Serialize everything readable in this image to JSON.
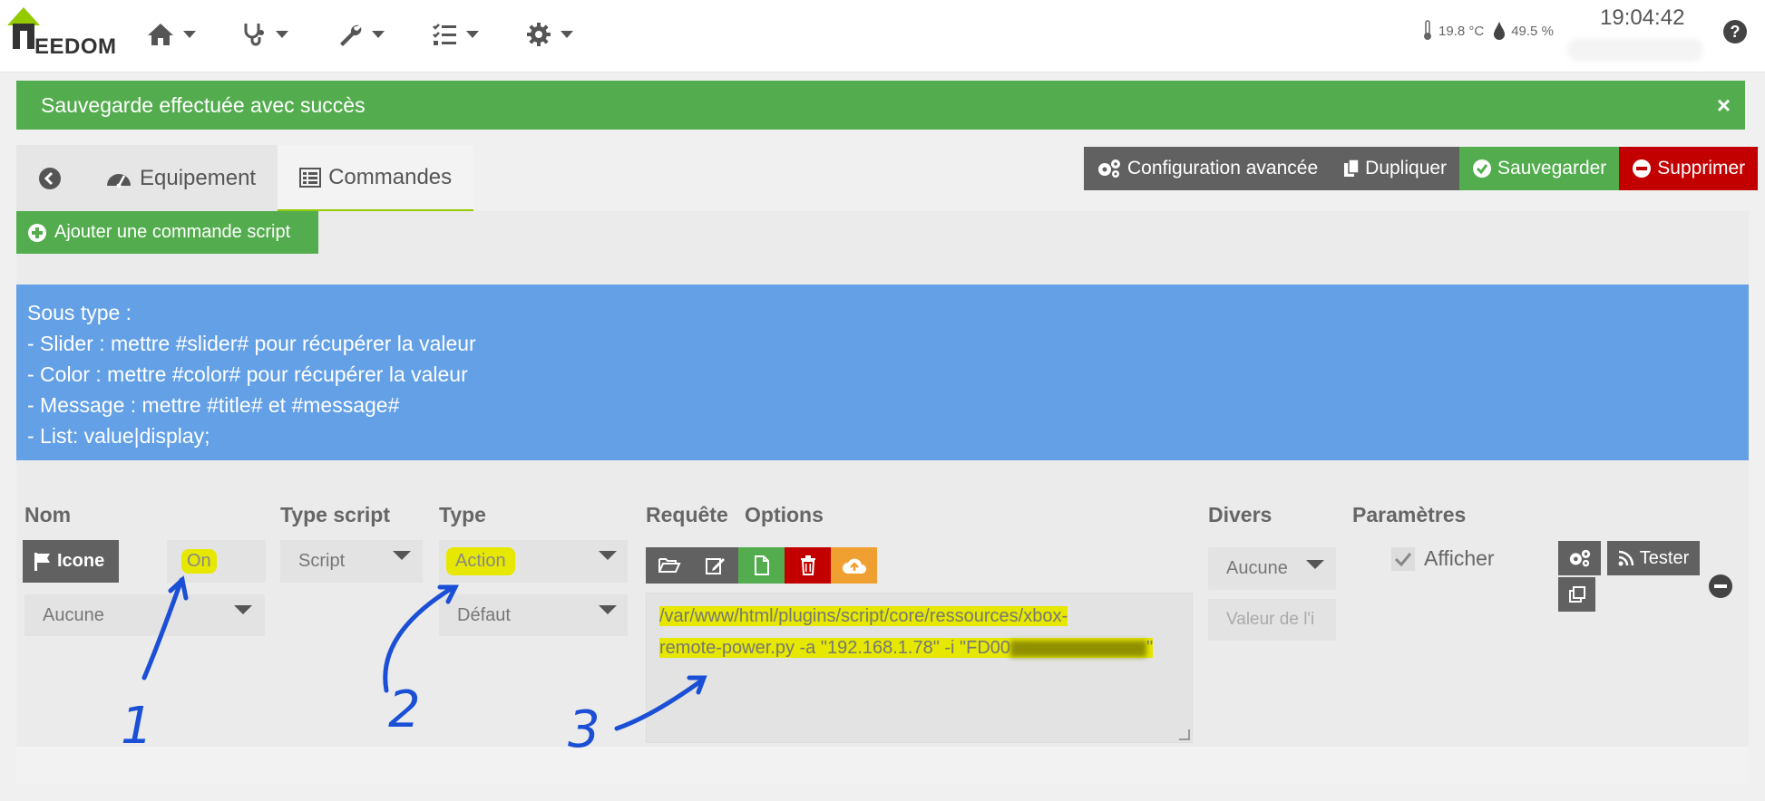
{
  "nav": {
    "logo_text": "EEDOM",
    "logo_letter": "J",
    "menus": [
      "home-icon",
      "stethoscope-icon",
      "wrench-icon",
      "tasks-icon",
      "gear-icon"
    ],
    "temperature": "19.8 °C",
    "humidity": "49.5 %",
    "time": "19:04:42",
    "help_label": "?"
  },
  "alert": {
    "message": "Sauvegarde effectuée avec succès",
    "close": "×"
  },
  "tabs": {
    "equipement": "Equipement",
    "commandes": "Commandes"
  },
  "toolbar": {
    "config": "Configuration avancée",
    "duplicate": "Dupliquer",
    "save": "Sauvegarder",
    "delete": "Supprimer"
  },
  "add_command": "Ajouter une commande script",
  "info": {
    "line1": "Sous type :",
    "line2": "- Slider : mettre #slider# pour récupérer la valeur",
    "line3": "- Color : mettre #color# pour récupérer la valeur",
    "line4": "- Message : mettre #title# et #message#",
    "line5": "- List: value|display;"
  },
  "headers": {
    "nom": "Nom",
    "type_script": "Type script",
    "type": "Type",
    "requete": "Requête",
    "options": "Options",
    "divers": "Divers",
    "parametres": "Paramètres"
  },
  "row": {
    "icon_label": "Icone",
    "name_value": "On",
    "value_select": "Aucune",
    "type_script": "Script",
    "type": "Action",
    "subtype": "Défaut",
    "request_line1": "/var/www/html/plugins/script/core/ressources/xbox-",
    "request_line2": "remote-power.py  -a \"192.168.1.78\" -i \"FD00",
    "request_line2_end": "\"",
    "divers_select": "Aucune",
    "divers_placeholder": "Valeur de l'i",
    "afficher": "Afficher",
    "tester": "Tester"
  },
  "annotations": [
    "1",
    "2",
    "3"
  ],
  "colors": {
    "green": "#53ad4e",
    "red": "#c30000",
    "dark": "#616161",
    "blue_info": "#63a0e6",
    "highlight": "#e6e800",
    "annotation": "#1a4fd6"
  }
}
